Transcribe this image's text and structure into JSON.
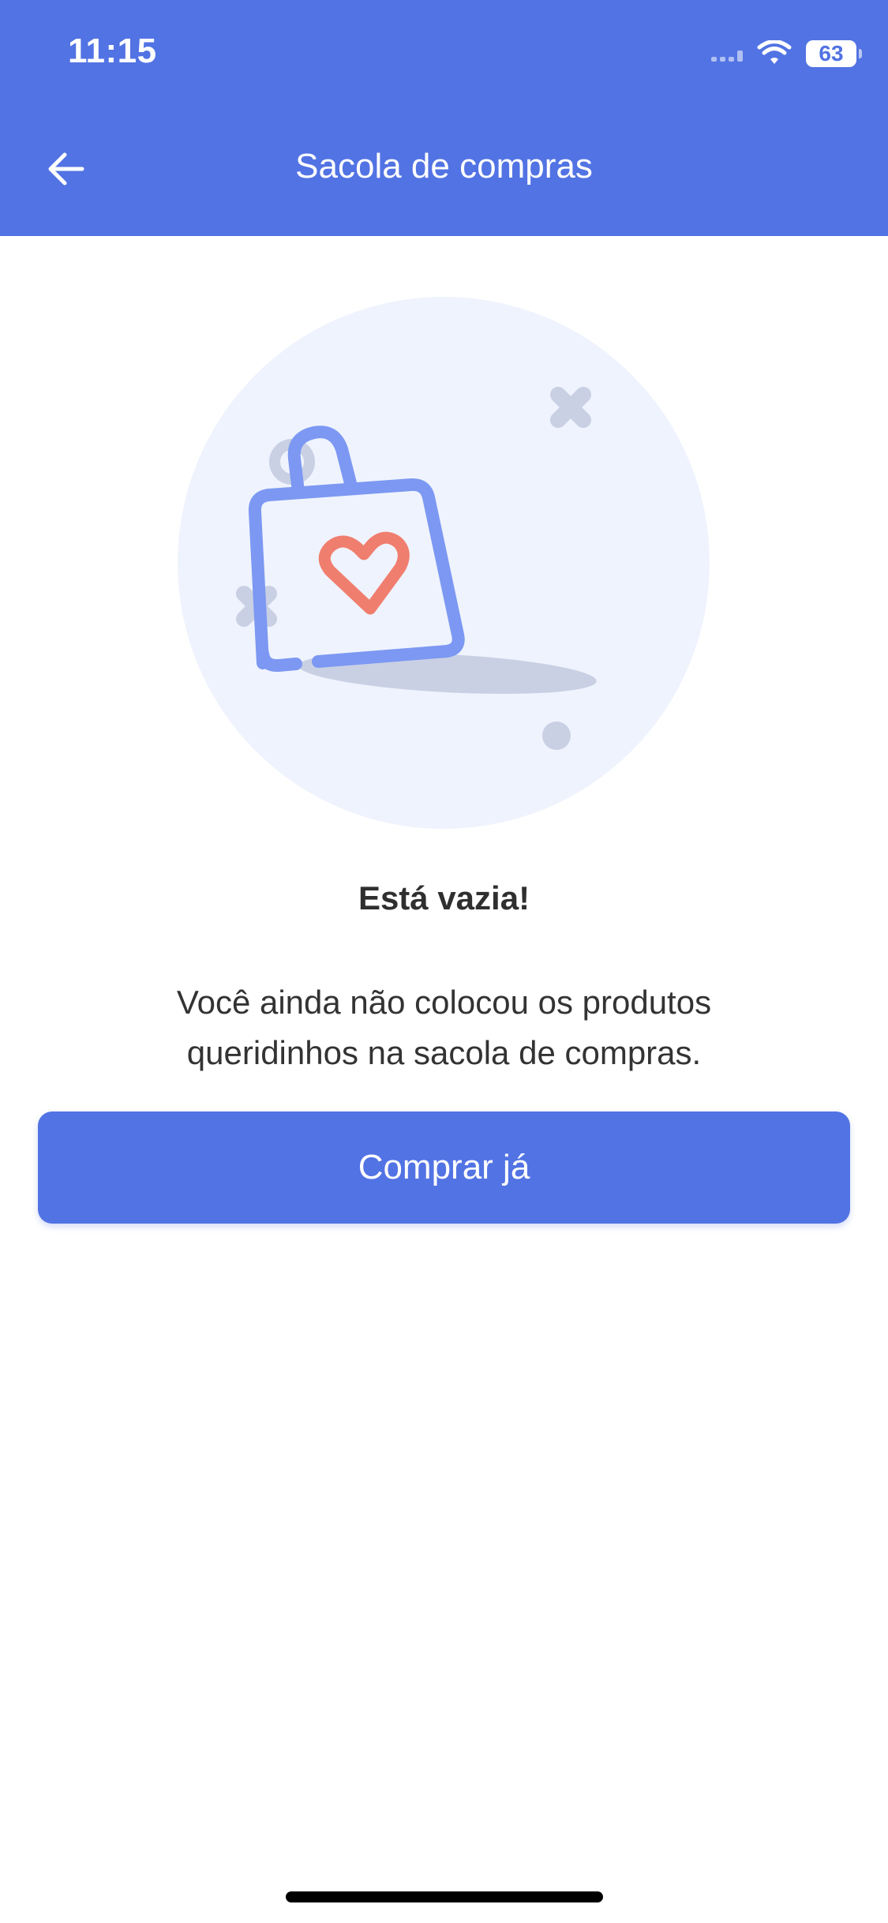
{
  "status_bar": {
    "time": "11:15",
    "battery": "63",
    "icons": [
      "signal-icon",
      "wifi-icon",
      "battery-icon"
    ]
  },
  "header": {
    "title": "Sacola de compras",
    "back_icon": "arrow-left-icon",
    "background": "#5273E3"
  },
  "illustration": {
    "name": "empty-shopping-bag-illustration",
    "colors": {
      "circle": "#EFF3FD",
      "bag": "#7C98F2",
      "heart": "#F07E6E",
      "decor": "#C9D0E4"
    }
  },
  "empty_state": {
    "title": "Está vazia!",
    "description": "Você ainda não colocou os produtos queridinhos na sacola de compras."
  },
  "cta": {
    "label": "Comprar já",
    "color": "#5273E3"
  }
}
